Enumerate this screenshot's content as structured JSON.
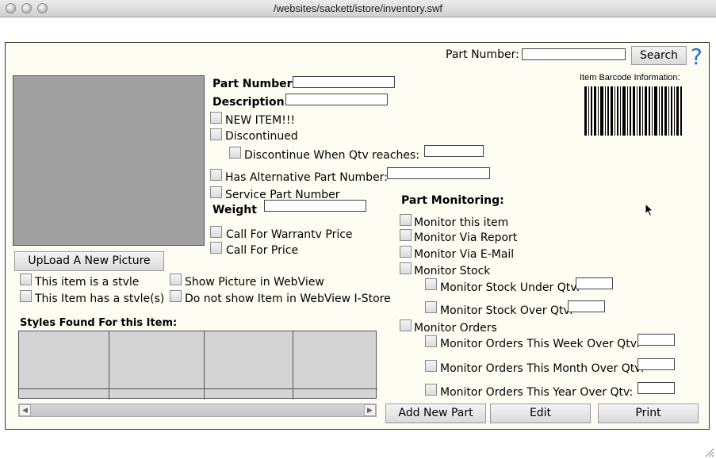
{
  "window": {
    "title": "/websites/sackett/istore/inventory.swf"
  },
  "search": {
    "label": "Part Number:",
    "value": "",
    "button": "Search",
    "help": "?"
  },
  "barcode": {
    "caption": "Item Barcode Information:"
  },
  "part": {
    "part_number_label": "Part Number:",
    "description_label": "Description:",
    "new_item": "NEW ITEM!!!",
    "discontinued": "Discontinued",
    "discontinue_when": "Discontinue When Qtv reaches:",
    "has_alt": "Has Alternative Part Number:",
    "service_part": "Service Part Number",
    "weight": "Weight",
    "call_warranty": "Call For Warrantv Price",
    "call_price": "Call For Price"
  },
  "picture": {
    "upload_button": "UpLoad A New Picture",
    "is_style": "This item is a stvle",
    "has_style": "This Item has a stvle(s)",
    "show_picture": "Show Picture in WebView",
    "dont_show": "Do not show Item in WebView I-Store"
  },
  "styles": {
    "title": "Styles Found For this Item:"
  },
  "monitoring": {
    "title": "Part Monitoring:",
    "monitor_item": "Monitor this item",
    "via_report": "Monitor Via Report",
    "via_email": "Monitor Via E-Mail",
    "monitor_stock": "Monitor Stock",
    "stock_under": "Monitor Stock Under Qtv:",
    "stock_over": "Monitor Stock Over Qtv:",
    "monitor_orders": "Monitor Orders",
    "orders_week": "Monitor Orders This Week Over Qtv:",
    "orders_month": "Monitor Orders This Month Over Qtv:",
    "orders_year": "Monitor Orders This Year Over Qtv:"
  },
  "actions": {
    "add": "Add New Part",
    "edit": "Edit",
    "print": "Print"
  }
}
